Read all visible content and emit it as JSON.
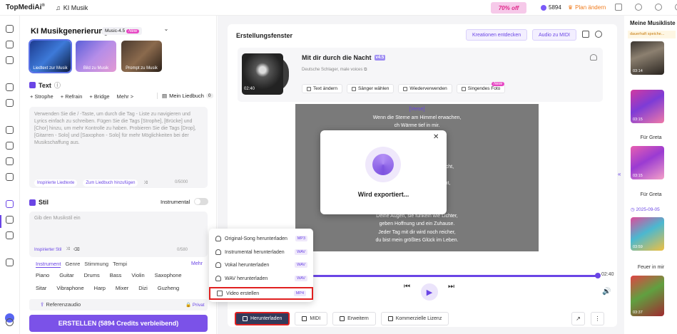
{
  "topbar": {
    "logo": "TopMediAi",
    "logo_sup": "®",
    "app_name": "KI Musik",
    "promo": "70% off",
    "credits": "5894",
    "plan": "Plan ändern"
  },
  "left": {
    "title": "KI Musikgenerierung",
    "version": "Music-4.5",
    "version_badge": "New",
    "modes": [
      "Liedtext zur Musik",
      "Bild zu Musik",
      "Prompt zu Musik"
    ],
    "text_section": "Text",
    "chips": [
      "+ Strophe",
      "+ Refrain",
      "+ Bridge",
      "Mehr >"
    ],
    "my_songbook": "Mein Liedbuch",
    "my_songbook_count": "0",
    "lyrics_placeholder": "Verwenden Sie die / -Taste, um durch die Tag - Liste zu navigieren und Lyrics einfach zu schreiben. Fügen Sie die Tags [Strophe], [Brücke] und [Chor] hinzu, um mehr Kontrolle zu haben. Probieren Sie die Tags [Drop], [Gitarren - Solo] und [Saxophon - Solo] für mehr Möglichkeiten bei der Musikschaffung aus.",
    "inspired_lyrics": "Inspirierte Liedtexte",
    "add_songbook": "Zum Liedbuch hinzufügen",
    "lyrics_count": "0/5000",
    "style_section": "Stil",
    "instrumental": "Instrumental",
    "style_placeholder": "Gib den Musikstil ein",
    "inspired_style": "Inspirierter Stil",
    "style_count": "0/580",
    "tag_tabs": [
      "Instrument",
      "Genre",
      "Stimmung",
      "Tempi"
    ],
    "tag_more": "Mehr",
    "tags": [
      "Piano",
      "Guitar",
      "Drums",
      "Bass",
      "Violin",
      "Saxophone",
      "Sitar",
      "Vibraphone",
      "Harp",
      "Mixer",
      "Dizi",
      "Guzheng"
    ],
    "reference_audio": "Referenzaudio",
    "private": "Privat",
    "create_button": "ERSTELLEN (5894 Credits verbleibend)"
  },
  "center": {
    "title": "Erstellungsfenster",
    "discover": "Kreationen entdecken",
    "audio_to_midi": "Audio zu MIDI",
    "song": {
      "title": "Mit dir durch die Nacht",
      "version": "v4.5",
      "genre": "Deutsche Schlager, male voices",
      "duration": "02:40"
    },
    "actions": [
      "Text ändern",
      "Sänger wählen",
      "Wiederverwenden",
      "Singendes Foto"
    ],
    "actions_new": "New",
    "lyrics": [
      "[Verse]",
      "Wenn die Sterne am Himmel erwachen,",
      "ch Wärme tief in mir.",
      "lässt mein Herz lachen,",
      "ist so schön mit dir.",
      "",
      "[Chorus]",
      "e Nacht, bis der Morgen erwacht,",
      "Hand, für immer vereint.",
      "Nacht, alles wird neu entfacht,",
      "ebe uns für immer scheint.",
      "",
      "[Chorus]",
      "Deine Augen, sie funkeln wie Lichter,",
      "geben Hoffnung und ein Zuhause.",
      "Jeder Tag mit dir wird noch reicher,",
      "du bist mein größtes Glück im Leben."
    ],
    "modal_text": "Wird exportiert...",
    "time": "02:40",
    "progress": 1.0,
    "download": "Herunterladen",
    "midi": "MIDI",
    "extend": "Erweitern",
    "license": "Kommerzielle Lizenz"
  },
  "dropdown": [
    {
      "label": "Original-Song herunterladen",
      "fmt": "MP3"
    },
    {
      "label": "Instrumental herunterladen",
      "fmt": "WAV"
    },
    {
      "label": "Vokal herunterladen",
      "fmt": "WAV"
    },
    {
      "label": "WAV herunterladen",
      "fmt": "WAV"
    },
    {
      "label": "Video erstellen",
      "fmt": "MP4"
    }
  ],
  "right": {
    "title": "Meine Musikliste",
    "note": "dauerhaft speiche...",
    "items": [
      {
        "dur": "03:14",
        "title": "Für Greta"
      },
      {
        "dur": "03:15",
        "title": "Für Greta"
      },
      {
        "dur": "03:15",
        "title": "Für Greta"
      },
      {
        "dur": "03:59",
        "title": "Feuer in mir"
      },
      {
        "dur": "03:37",
        "title": ""
      }
    ],
    "date": "2025-09-05"
  }
}
